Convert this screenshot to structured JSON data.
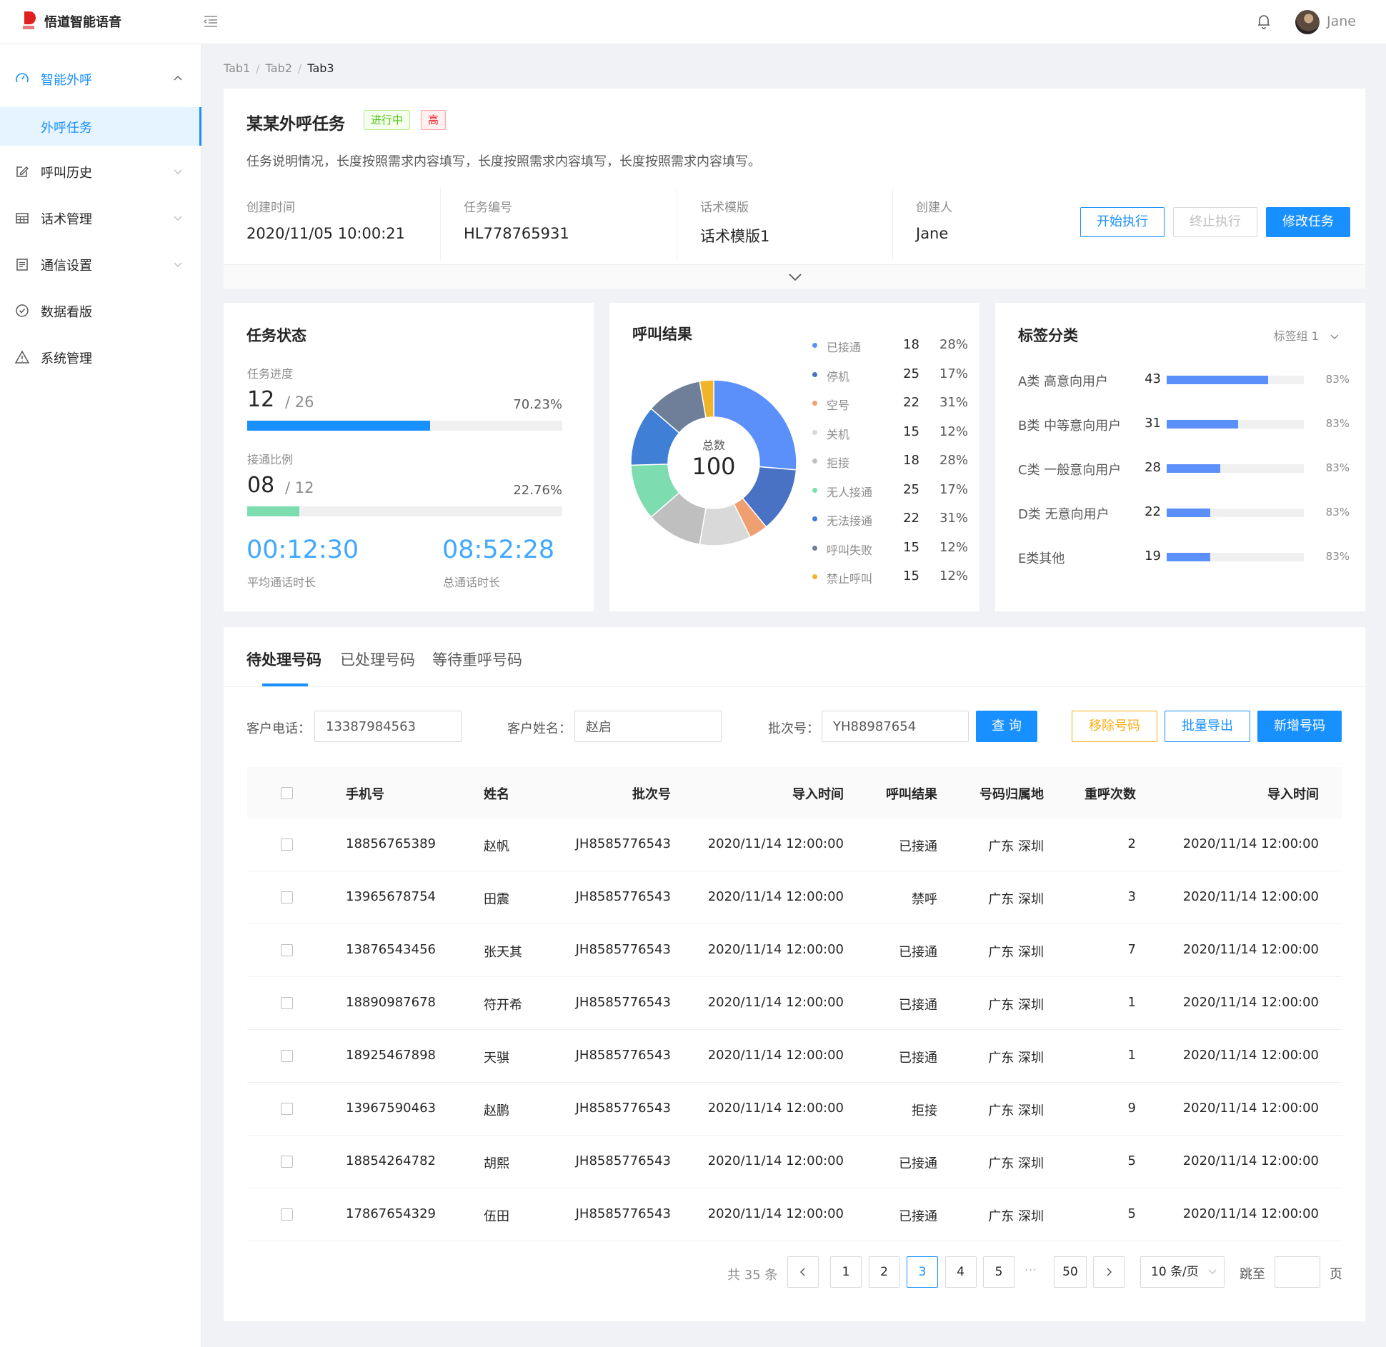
{
  "app": {
    "name": "悟道智能语音",
    "user": "Jane"
  },
  "sidebar": {
    "items": [
      {
        "label": "智能外呼",
        "icon": "dashboard-icon"
      },
      {
        "label": "外呼任务"
      },
      {
        "label": "呼叫历史",
        "icon": "edit-icon"
      },
      {
        "label": "话术管理",
        "icon": "table-icon"
      },
      {
        "label": "通信设置",
        "icon": "profile-icon"
      },
      {
        "label": "数据看版",
        "icon": "check-circle-icon"
      },
      {
        "label": "系统管理",
        "icon": "warning-icon"
      }
    ]
  },
  "breadcrumb": [
    "Tab1",
    "Tab2",
    "Tab3"
  ],
  "task": {
    "title": "某某外呼任务",
    "status_tag": "进行中",
    "priority_tag": "高",
    "description": "任务说明情况，长度按照需求内容填写，长度按照需求内容填写，长度按照需求内容填写。",
    "meta": [
      {
        "label": "创建时间",
        "value": "2020/11/05  10:00:21"
      },
      {
        "label": "任务编号",
        "value": "HL778765931"
      },
      {
        "label": "话术模版",
        "value": "话术模版1"
      },
      {
        "label": "创建人",
        "value": "Jane"
      }
    ],
    "buttons": {
      "start": "开始执行",
      "stop": "终止执行",
      "edit": "修改任务"
    }
  },
  "status_card": {
    "title": "任务状态",
    "progress_label": "任务进度",
    "progress_done": "12",
    "progress_total": "26",
    "progress_pct": "70.23%",
    "progress_value": 0.5814,
    "connect_label": "接通比例",
    "connect_done": "08",
    "connect_total": "12",
    "connect_pct": "22.76%",
    "connect_value": 0.165,
    "avg_time": "00:12:30",
    "avg_time_label": "平均通话时长",
    "total_time": "08:52:28",
    "total_time_label": "总通话时长"
  },
  "call_result": {
    "title": "呼叫结果",
    "center_label": "总数",
    "center_value": "100",
    "legend": [
      {
        "name": "已接通",
        "count": "18",
        "pct": "28%",
        "color": "#5b8ff9"
      },
      {
        "name": "停机",
        "count": "25",
        "pct": "17%",
        "color": "#4a72c4"
      },
      {
        "name": "空号",
        "count": "22",
        "pct": "31%",
        "color": "#f0a070"
      },
      {
        "name": "关机",
        "count": "15",
        "pct": "12%",
        "color": "#d9d9d9"
      },
      {
        "name": "拒接",
        "count": "18",
        "pct": "28%",
        "color": "#bfbfbf"
      },
      {
        "name": "无人接通",
        "count": "25",
        "pct": "17%",
        "color": "#7ddcb0"
      },
      {
        "name": "无法接通",
        "count": "22",
        "pct": "31%",
        "color": "#3f7fd6"
      },
      {
        "name": "呼叫失败",
        "count": "15",
        "pct": "12%",
        "color": "#6f7f99"
      },
      {
        "name": "禁止呼叫",
        "count": "15",
        "pct": "12%",
        "color": "#f0b429"
      }
    ]
  },
  "chart_data": {
    "type": "pie",
    "variant": "donut",
    "title": "呼叫结果",
    "total": 100,
    "categories": [
      "已接通",
      "停机",
      "空号",
      "关机",
      "拒接",
      "无人接通",
      "无法接通",
      "呼叫失败",
      "禁止呼叫"
    ],
    "values": [
      18,
      25,
      22,
      15,
      18,
      25,
      22,
      15,
      15
    ],
    "percent_labels": [
      "28%",
      "17%",
      "31%",
      "12%",
      "28%",
      "17%",
      "31%",
      "12%",
      "12%"
    ],
    "visual_share": [
      0.29,
      0.14,
      0.04,
      0.11,
      0.12,
      0.12,
      0.13,
      0.12,
      0.03
    ],
    "legend": "right"
  },
  "tag_card": {
    "title": "标签分类",
    "group_select": "标签组 1",
    "rows": [
      {
        "name": "A类 高意向用户",
        "count": "43",
        "pct": "83%",
        "fill": 0.74
      },
      {
        "name": "B类 中等意向用户",
        "count": "31",
        "pct": "83%",
        "fill": 0.52
      },
      {
        "name": "C类 一般意向用户",
        "count": "28",
        "pct": "83%",
        "fill": 0.39
      },
      {
        "name": "D类 无意向用户",
        "count": "22",
        "pct": "83%",
        "fill": 0.32
      },
      {
        "name": "E类其他",
        "count": "19",
        "pct": "83%",
        "fill": 0.32
      }
    ]
  },
  "numbers": {
    "tabs": [
      "待处理号码",
      "已处理号码",
      "等待重呼号码"
    ],
    "filters": {
      "phone_label": "客户电话：",
      "phone_value": "13387984563",
      "name_label": "客户姓名：",
      "name_value": "赵启",
      "batch_label": "批次号：",
      "batch_value": "YH88987654"
    },
    "buttons": {
      "query": "查 询",
      "remove": "移除号码",
      "export": "批量导出",
      "add": "新增号码"
    },
    "columns": [
      "手机号",
      "姓名",
      "批次号",
      "导入时间",
      "呼叫结果",
      "号码归属地",
      "重呼次数",
      "导入时间"
    ],
    "rows": [
      [
        "18856765389",
        "赵帆",
        "JH8585776543",
        "2020/11/14 12:00:00",
        "已接通",
        "广东 深圳",
        "2",
        "2020/11/14 12:00:00"
      ],
      [
        "13965678754",
        "田震",
        "JH8585776543",
        "2020/11/14 12:00:00",
        "禁呼",
        "广东 深圳",
        "3",
        "2020/11/14 12:00:00"
      ],
      [
        "13876543456",
        "张天其",
        "JH8585776543",
        "2020/11/14 12:00:00",
        "已接通",
        "广东 深圳",
        "7",
        "2020/11/14 12:00:00"
      ],
      [
        "18890987678",
        "符开希",
        "JH8585776543",
        "2020/11/14 12:00:00",
        "已接通",
        "广东 深圳",
        "1",
        "2020/11/14 12:00:00"
      ],
      [
        "18925467898",
        "天骐",
        "JH8585776543",
        "2020/11/14 12:00:00",
        "已接通",
        "广东 深圳",
        "1",
        "2020/11/14 12:00:00"
      ],
      [
        "13967590463",
        "赵鹏",
        "JH8585776543",
        "2020/11/14 12:00:00",
        "拒接",
        "广东 深圳",
        "9",
        "2020/11/14 12:00:00"
      ],
      [
        "18854264782",
        "胡熙",
        "JH8585776543",
        "2020/11/14 12:00:00",
        "已接通",
        "广东 深圳",
        "5",
        "2020/11/14 12:00:00"
      ],
      [
        "17867654329",
        "伍田",
        "JH8585776543",
        "2020/11/14 12:00:00",
        "已接通",
        "广东 深圳",
        "5",
        "2020/11/14 12:00:00"
      ]
    ]
  },
  "pagination": {
    "total": "共 35 条",
    "pages": [
      "1",
      "2",
      "3",
      "4",
      "5"
    ],
    "current": "3",
    "ellipsis": "···",
    "last": "50",
    "size": "10 条/页",
    "jump_label": "跳至",
    "page_unit": "页"
  },
  "colors": {
    "primary": "#1890ff",
    "success": "#52c41a",
    "danger": "#f5222d",
    "warning": "#faad14",
    "teal": "#7ddcb0"
  }
}
